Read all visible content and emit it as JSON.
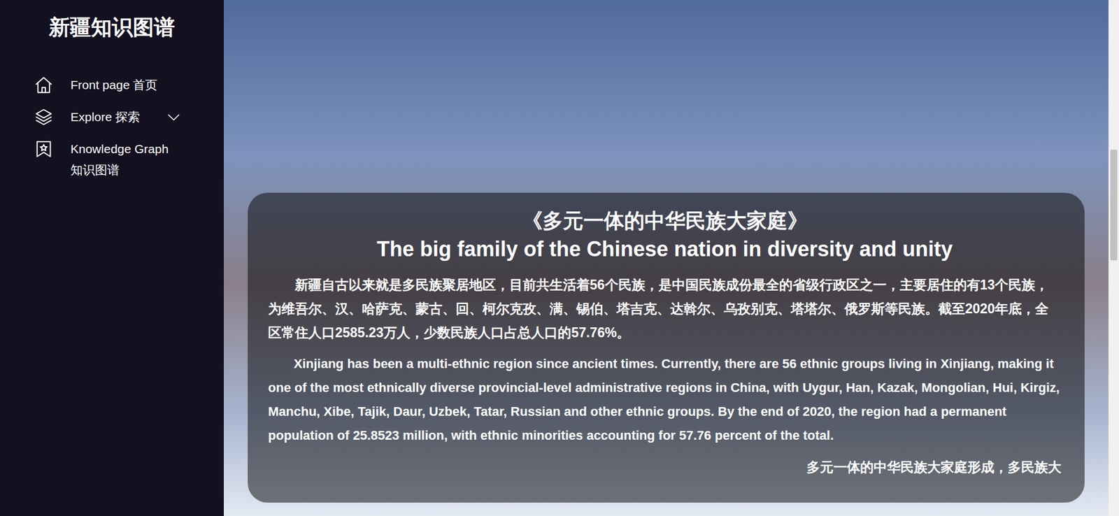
{
  "sidebar": {
    "title": "新疆知识图谱",
    "items": [
      {
        "label": "Front page 首页",
        "selected": false,
        "expanded": false,
        "has_chevron": false
      },
      {
        "label": "Explore 探索",
        "selected": false,
        "expanded": false,
        "has_chevron": true
      },
      {
        "label": "Knowledge Graph 知识图谱",
        "selected": false,
        "expanded": false,
        "has_chevron": false
      }
    ]
  },
  "article": {
    "title_zh": "《多元一体的中华民族大家庭》",
    "title_en": "The big family of the Chinese nation in diversity and unity",
    "paragraph_zh": "新疆自古以来就是多民族聚居地区，目前共生活着56个民族，是中国民族成份最全的省级行政区之一，主要居住的有13个民族，为维吾尔、汉、哈萨克、蒙古、回、柯尔克孜、满、锡伯、塔吉克、达斡尔、乌孜别克、塔塔尔、俄罗斯等民族。截至2020年底，全区常住人口2585.23万人，少数民族人口占总人口的57.76%。",
    "paragraph_en": "Xinjiang has been a multi-ethnic region since ancient times. Currently, there are 56 ethnic groups living in Xinjiang, making it one of the most ethnically diverse provincial-level administrative regions in China, with Uygur, Han, Kazak, Mongolian, Hui, Kirgiz, Manchu, Xibe, Tajik, Daur, Uzbek, Tatar, Russian and other ethnic groups. By the end of 2020, the region had a permanent population of 25.8523 million, with ethnic minorities accounting for 57.76 percent of the total.",
    "next_heading": "多元一体的中华民族大家庭形成，多民族大"
  }
}
